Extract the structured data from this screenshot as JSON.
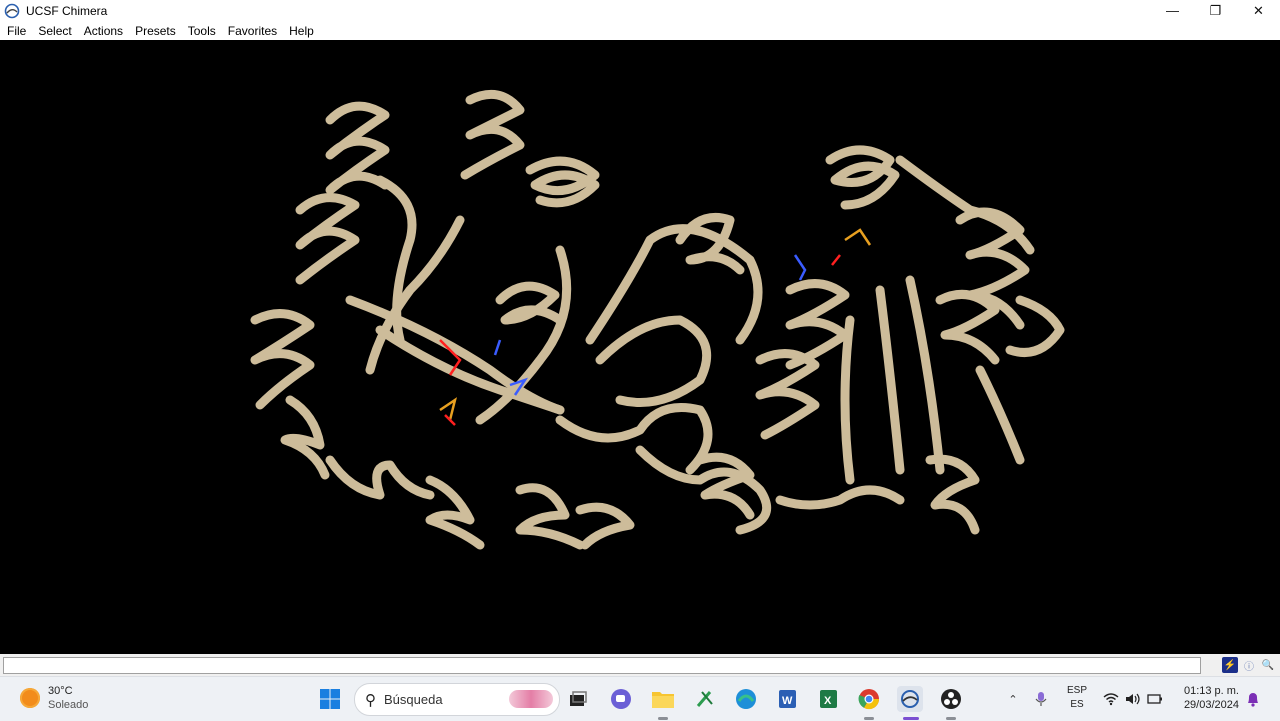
{
  "window": {
    "title": "UCSF Chimera",
    "controls": {
      "minimize": "—",
      "restore": "❐",
      "close": "✕"
    }
  },
  "menu": [
    "File",
    "Select",
    "Actions",
    "Presets",
    "Tools",
    "Favorites",
    "Help"
  ],
  "viewer": {
    "background": "#000000",
    "ribbon_color": "#d9c7a3",
    "atom_colors": {
      "oxygen": "#ff2020",
      "nitrogen": "#3a5cff",
      "phosphorus": "#e8a020"
    }
  },
  "taskbar": {
    "weather": {
      "temp": "30°C",
      "condition": "Soleado"
    },
    "search_placeholder": "Búsqueda",
    "language": {
      "top": "ESP",
      "bottom": "ES"
    },
    "clock": {
      "time": "01:13 p. m.",
      "date": "29/03/2024"
    }
  }
}
